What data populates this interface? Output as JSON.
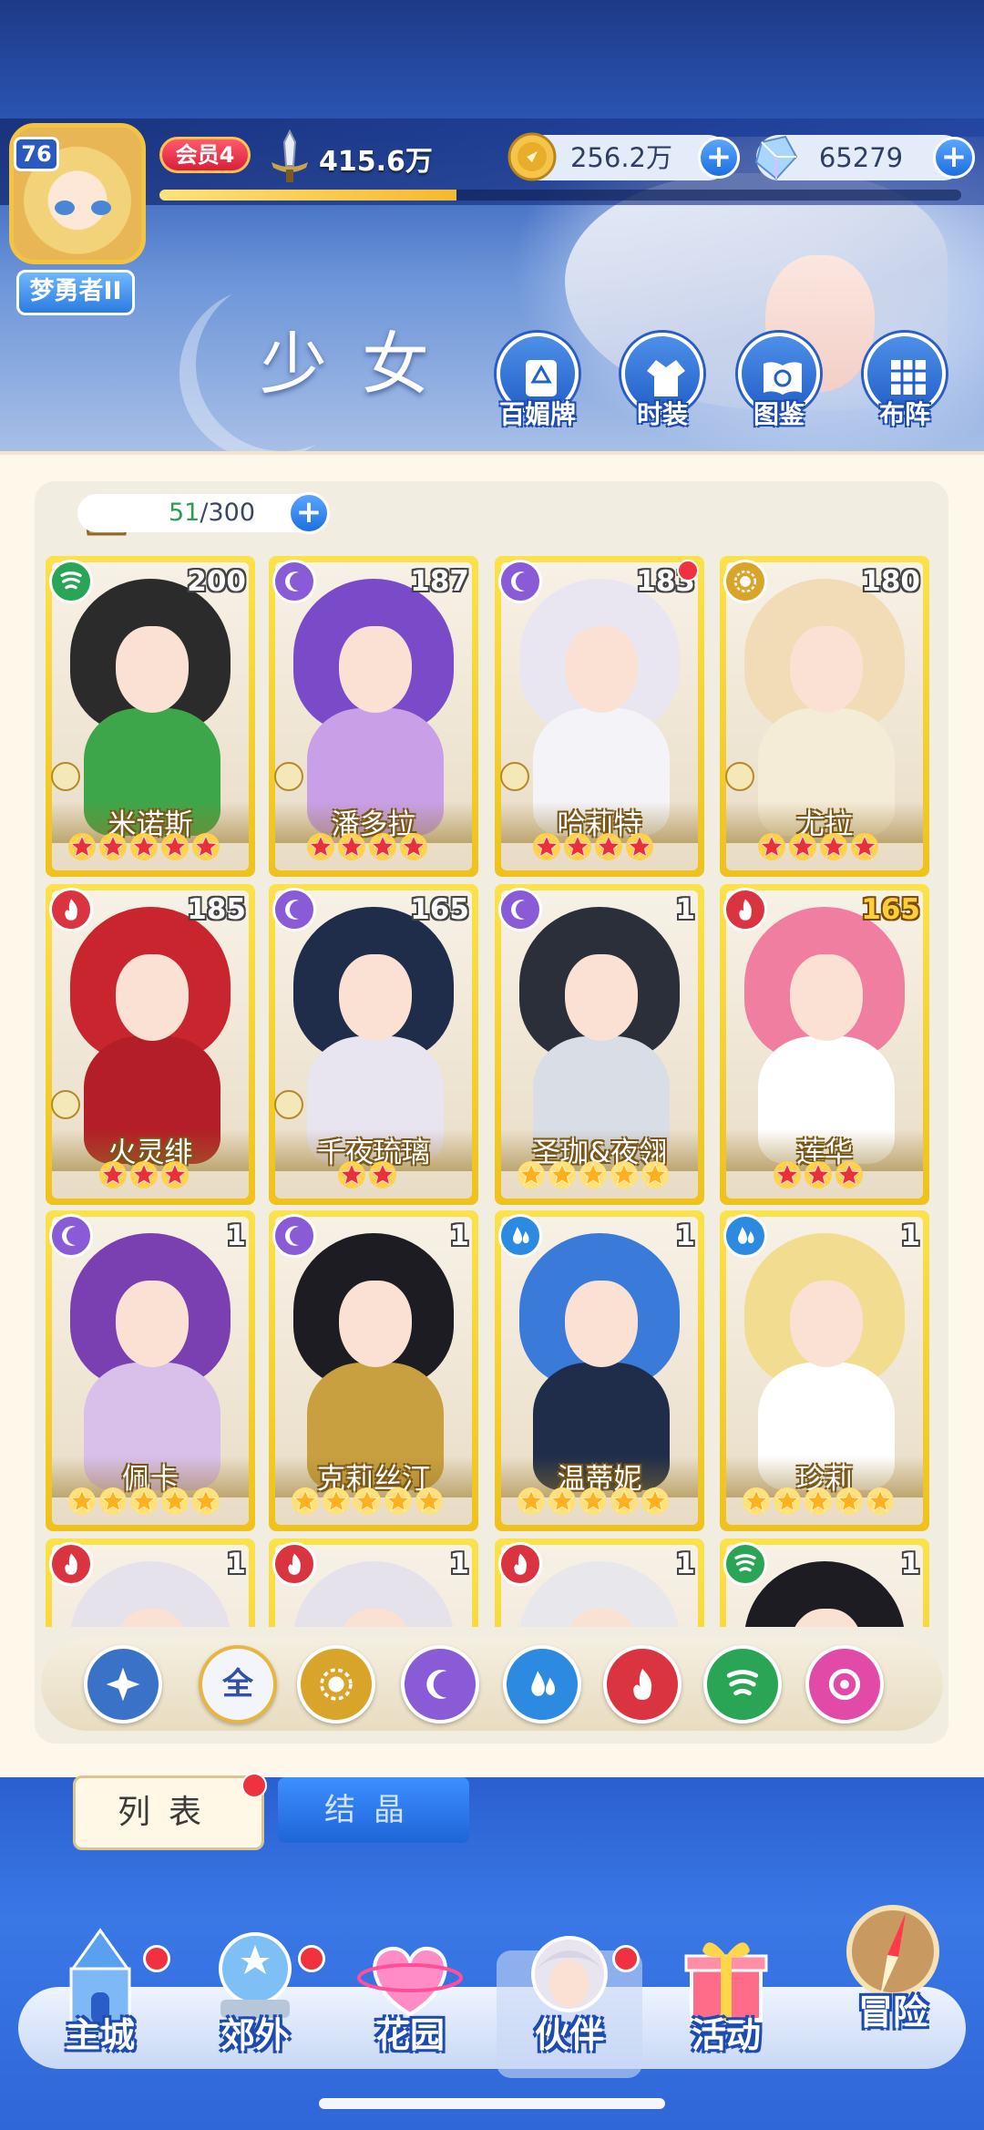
{
  "player": {
    "level": "76",
    "title": "梦勇者II",
    "vip": "会员4",
    "power": "415.6万",
    "exp_fraction": 0.37
  },
  "currency": {
    "gold": "256.2万",
    "gems": "65279"
  },
  "header": {
    "section_title": "少女",
    "buttons": [
      {
        "label": "百媚牌",
        "icon": "card-deck-icon"
      },
      {
        "label": "时装",
        "icon": "outfit-icon"
      },
      {
        "label": "图鉴",
        "icon": "book-icon"
      },
      {
        "label": "布阵",
        "icon": "formation-grid-icon"
      }
    ]
  },
  "roster": {
    "count_current": "51",
    "count_max": "/300"
  },
  "cards": [
    {
      "name": "米诺斯",
      "level": "200",
      "stars": 5,
      "element": "wind",
      "role": true,
      "dot": false,
      "gold_level": false
    },
    {
      "name": "潘多拉",
      "level": "187",
      "stars": 4,
      "element": "moon",
      "role": true,
      "dot": false,
      "gold_level": false
    },
    {
      "name": "哈莉特",
      "level": "183",
      "stars": 4,
      "element": "moon",
      "role": true,
      "dot": true,
      "gold_level": false
    },
    {
      "name": "尤拉",
      "level": "180",
      "stars": 4,
      "element": "sun",
      "role": true,
      "dot": false,
      "gold_level": false
    },
    {
      "name": "火灵绯",
      "level": "185",
      "stars": 3,
      "element": "fire",
      "role": true,
      "dot": false,
      "gold_level": false
    },
    {
      "name": "千夜琉璃",
      "level": "165",
      "stars": 2,
      "element": "moon",
      "role": true,
      "dot": false,
      "gold_level": false
    },
    {
      "name": "圣珈&夜翎",
      "level": "1",
      "stars": 5,
      "element": "moon",
      "role": false,
      "dot": false,
      "gold_level": false,
      "gold_stars": true
    },
    {
      "name": "莲华",
      "level": "165",
      "stars": 3,
      "element": "fire",
      "role": false,
      "dot": false,
      "gold_level": true
    },
    {
      "name": "佩卡",
      "level": "1",
      "stars": 5,
      "element": "moon",
      "role": false,
      "dot": false,
      "gold_level": false,
      "gold_stars": true
    },
    {
      "name": "克莉丝汀",
      "level": "1",
      "stars": 5,
      "element": "moon",
      "role": false,
      "dot": false,
      "gold_level": false,
      "gold_stars": true
    },
    {
      "name": "温蒂妮",
      "level": "1",
      "stars": 5,
      "element": "water",
      "role": false,
      "dot": false,
      "gold_level": false,
      "gold_stars": true
    },
    {
      "name": "珍莉",
      "level": "1",
      "stars": 5,
      "element": "water",
      "role": false,
      "dot": false,
      "gold_level": false,
      "gold_stars": true
    },
    {
      "name": "",
      "level": "1",
      "stars": 0,
      "element": "fire",
      "role": false,
      "dot": false,
      "gold_level": false
    },
    {
      "name": "",
      "level": "1",
      "stars": 0,
      "element": "fire",
      "role": false,
      "dot": false,
      "gold_level": false
    },
    {
      "name": "",
      "level": "1",
      "stars": 0,
      "element": "fire",
      "role": false,
      "dot": false,
      "gold_level": false
    },
    {
      "name": "",
      "level": "1",
      "stars": 0,
      "element": "wind",
      "role": false,
      "dot": false,
      "gold_level": false
    }
  ],
  "filters": [
    {
      "id": "default",
      "icon": "compass-star-icon",
      "text": ""
    },
    {
      "id": "all",
      "icon": "all-icon",
      "text": "全"
    },
    {
      "id": "sun",
      "icon": "sun-element-icon",
      "text": ""
    },
    {
      "id": "moon",
      "icon": "moon-element-icon",
      "text": ""
    },
    {
      "id": "water",
      "icon": "water-element-icon",
      "text": ""
    },
    {
      "id": "fire",
      "icon": "fire-element-icon",
      "text": ""
    },
    {
      "id": "wind",
      "icon": "wind-element-icon",
      "text": ""
    },
    {
      "id": "arcane",
      "icon": "arcane-element-icon",
      "text": ""
    }
  ],
  "tabs": {
    "list": "列表",
    "crystal": "结晶"
  },
  "nav": [
    {
      "label": "主城",
      "icon": "castle-icon",
      "dot": true,
      "active": false
    },
    {
      "label": "郊外",
      "icon": "portal-icon",
      "dot": true,
      "active": false
    },
    {
      "label": "花园",
      "icon": "heart-garden-icon",
      "dot": false,
      "active": false
    },
    {
      "label": "伙伴",
      "icon": "partner-portrait-icon",
      "dot": true,
      "active": true
    },
    {
      "label": "活动",
      "icon": "gift-box-icon",
      "dot": false,
      "active": false
    },
    {
      "label": "冒险",
      "icon": "compass-icon",
      "dot": false,
      "active": false
    }
  ],
  "colors": {
    "fire": "#d9343f",
    "moon": "#8a5bd6",
    "water": "#2c8be0",
    "wind": "#2aa556",
    "sun": "#d9a42a",
    "arcane": "#e24aa8",
    "default": "#3a72c8",
    "card_gold": "#f1c51f"
  }
}
